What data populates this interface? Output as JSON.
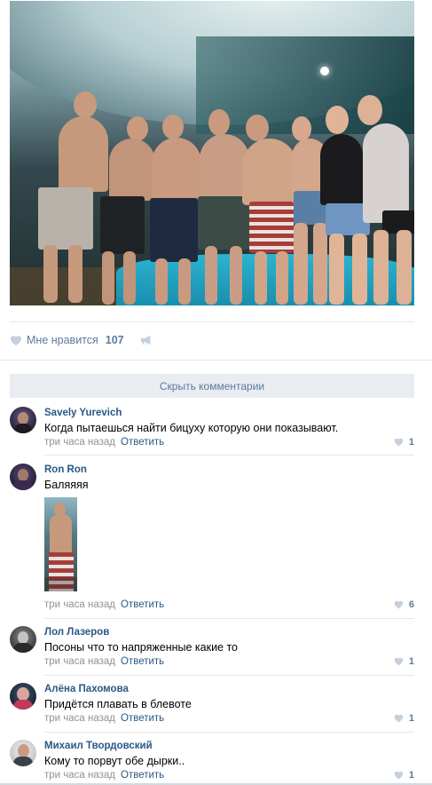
{
  "post": {
    "photo_icon": "post-photo",
    "likes": {
      "label": "Мне нравится",
      "count": "107"
    }
  },
  "comments_toggle": {
    "label": "Скрыть комментарии"
  },
  "comments": [
    {
      "author": "Savely Yurevich",
      "text": "Когда пытаешься найти бицуху которую они показывают.",
      "time": "три часа назад",
      "reply": "Ответить",
      "likes": "1",
      "avatar_color": "#3a3150"
    },
    {
      "author": "Ron Ron",
      "text": "Баляяяя",
      "time": "три часа назад",
      "reply": "Ответить",
      "likes": "6",
      "avatar_color": "#4a3b63"
    },
    {
      "author": "Лол Лазеров",
      "text": "Посоны что то напряженные какие то",
      "time": "три часа назад",
      "reply": "Ответить",
      "likes": "1",
      "avatar_color": "#4b4b4b"
    },
    {
      "author": "Алёна Пахомова",
      "text": "Придётся плавать в блевоте",
      "time": "три часа назад",
      "reply": "Ответить",
      "likes": "1",
      "avatar_color": "#6d3b4a"
    },
    {
      "author": "Михаил Твордовский",
      "text": "Кому то порвут обе дырки..",
      "time": "три часа назад",
      "reply": "Ответить",
      "likes": "1",
      "avatar_color": "#c8ccd0"
    }
  ],
  "colors": {
    "link": "#2a5885",
    "muted": "#939393",
    "accent": "#5b7a9c",
    "bar_bg": "#e9edf1"
  }
}
